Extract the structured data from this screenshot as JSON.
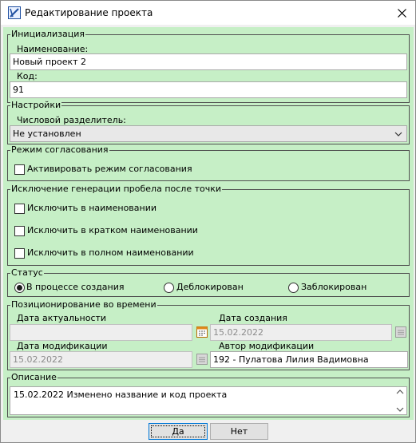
{
  "window": {
    "title": "Редактирование проекта"
  },
  "init": {
    "legend": "Инициализация",
    "name_label": "Наименование:",
    "name_value": "Новый проект 2",
    "code_label": "Код:",
    "code_value": "91"
  },
  "settings": {
    "legend": "Настройки",
    "sep_label": "Числовой разделитель:",
    "sep_value": "Не установлен"
  },
  "approval": {
    "legend": "Режим согласования",
    "activate_label": "Активировать режим согласования",
    "activate_checked": false
  },
  "space_exclusion": {
    "legend": "Исключение генерации пробела после точки",
    "items": [
      {
        "label": "Исключить в наименовании",
        "checked": false
      },
      {
        "label": "Исключить в кратком наименовании",
        "checked": false
      },
      {
        "label": "Исключить в полном наименовании",
        "checked": false
      }
    ]
  },
  "status": {
    "legend": "Статус",
    "options": [
      {
        "label": "В процессе создания",
        "selected": true
      },
      {
        "label": "Деблокирован",
        "selected": false
      },
      {
        "label": "Заблокирован",
        "selected": false
      }
    ]
  },
  "timing": {
    "legend": "Позиционирование во времени",
    "actual_label": "Дата актуальности",
    "actual_value": "",
    "created_label": "Дата создания",
    "created_value": "15.02.2022",
    "modified_label": "Дата модификации",
    "modified_value": "15.02.2022",
    "author_label": "Автор модификации",
    "author_value": "192 - Пулатова Лилия Вадимовна"
  },
  "description": {
    "legend": "Описание",
    "value": "15.02.2022 Изменено название и код проекта"
  },
  "buttons": {
    "ok": "Да",
    "cancel": "Нет"
  },
  "colors": {
    "panel_bg": "#c6efc6",
    "accent": "#0078d7"
  },
  "icons": {
    "app": "project-app-icon",
    "close": "close-icon",
    "calendar": "calendar-icon",
    "dropdown": "chevron-down-icon"
  }
}
